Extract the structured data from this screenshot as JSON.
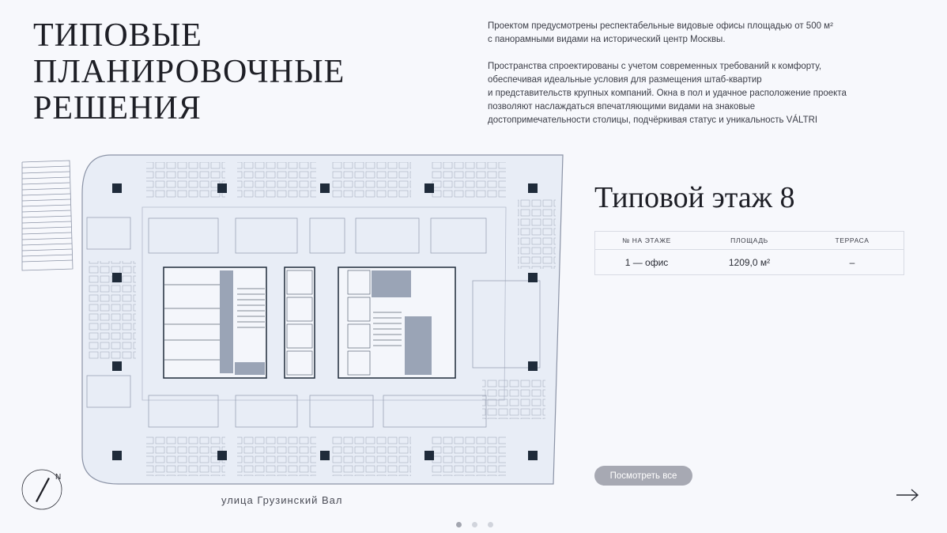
{
  "header": {
    "title_lines": [
      "ТИПОВЫЕ",
      "ПЛАНИРОВОЧНЫЕ",
      "РЕШЕНИЯ"
    ]
  },
  "intro": {
    "p1_line1": "Проектом предусмотрены респектабельные видовые офисы площадью от 500 м²",
    "p1_line2": "с панорамными видами на исторический центр Москвы.",
    "p2_line1": "Пространства спроектированы с учетом современных требований к комфорту,",
    "p2_line2": "обеспечивая идеальные условия для размещения штаб-квартир",
    "p2_line3": "и представительств крупных компаний. Окна в пол и удачное расположение проекта",
    "p2_line4": "позволяют наслаждаться впечатляющими видами на знаковые",
    "p2_line5": "достопримечательности столицы, подчёркивая статус и уникальность VÁLTRI"
  },
  "floor": {
    "title": "Типовой этаж 8",
    "table": {
      "headers": [
        "№ НА ЭТАЖЕ",
        "ПЛОЩАДЬ",
        "ТЕРРАСА"
      ],
      "rows": [
        [
          "1 — офис",
          "1209,0 м²",
          "–"
        ]
      ]
    }
  },
  "actions": {
    "view_all_label": "Посмотреть все"
  },
  "plan": {
    "street_label": "улица Грузинский Вал",
    "compass_letter": "N"
  },
  "pager": {
    "count": 3,
    "active_index": 0
  },
  "icons": {
    "next": "arrow-right-icon",
    "compass": "compass-icon"
  },
  "colors": {
    "background": "#f7f8fc",
    "text": "#1e1f26",
    "plan_fill": "#e8edf6",
    "plan_line": "#8b93a6",
    "column": "#1f2b3a",
    "button": "#a7a9b3"
  }
}
